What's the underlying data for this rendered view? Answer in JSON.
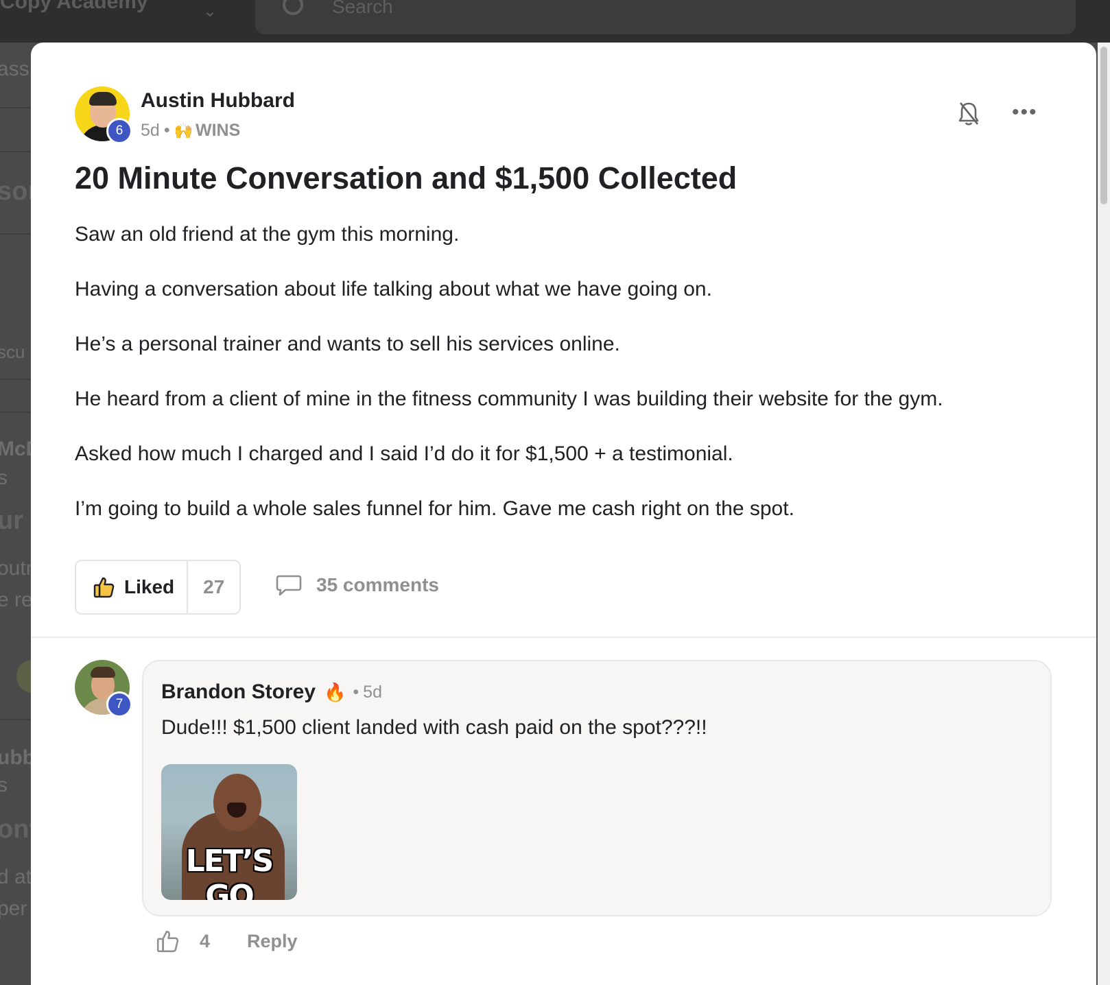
{
  "background": {
    "app_title": "Copy Academy",
    "search_placeholder": "Search",
    "fragments": [
      "ass",
      "sor",
      "scu",
      "McD",
      "s",
      "ur I",
      "outr",
      "e re",
      "ubb",
      "s",
      "onv",
      "d at",
      "per"
    ]
  },
  "post": {
    "author": {
      "name": "Austin Hubbard",
      "level": "6"
    },
    "time": "5d",
    "category_emoji": "🙌",
    "category": "WINS",
    "title": "20 Minute Conversation and $1,500 Collected",
    "body": [
      "Saw an old friend at the gym this morning.",
      "Having a conversation about life talking about what we have going on.",
      "He’s a personal trainer and wants to sell his services online.",
      "He heard from a client of mine in the fitness community I was building their website for the gym.",
      "Asked how much I charged and I said I’d do it for $1,500 + a testimonial.",
      "I’m going to build a whole sales funnel for him. Gave me cash right on the spot."
    ],
    "like_label": "Liked",
    "like_count": "27",
    "comments_label": "35 comments"
  },
  "comment": {
    "author": "Brandon Storey",
    "level": "7",
    "badge_emoji": "🔥",
    "time": "5d",
    "text": "Dude!!! $1,500 client landed with cash paid on the spot???!!",
    "gif_caption": "LET’S GO",
    "like_count": "4",
    "reply_label": "Reply"
  },
  "colors": {
    "level_badge": "#3e56c4",
    "avatar_yellow": "#f7d518",
    "muted_text": "#909090"
  }
}
